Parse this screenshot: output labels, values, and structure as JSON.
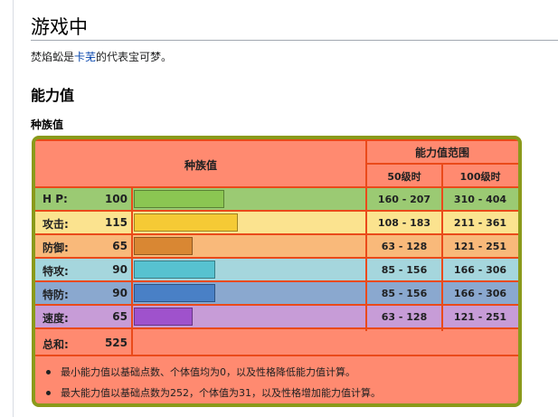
{
  "section_title": "游戏中",
  "intro": {
    "pokemon": "焚焰蚣",
    "mid": "是",
    "link": "卡芜",
    "tail": "的代表宝可梦。"
  },
  "stats_heading": "能力值",
  "base_heading": "种族值",
  "table": {
    "header_base": "种族值",
    "header_range": "能力值范围",
    "header_lv50": "50级时",
    "header_lv100": "100级时",
    "stats": [
      {
        "label": "H P:",
        "value": "100",
        "fraction": 0.392,
        "row_color": "#9bca73",
        "bar_color": "#8bc652",
        "lv50": "160 - 207",
        "lv100": "310 - 404"
      },
      {
        "label": "攻击:",
        "value": "115",
        "fraction": 0.451,
        "row_color": "#fbe38f",
        "bar_color": "#f5ca35",
        "lv50": "108 - 183",
        "lv100": "211 - 361"
      },
      {
        "label": "防御:",
        "value": "65",
        "fraction": 0.255,
        "row_color": "#f9b97a",
        "bar_color": "#d98733",
        "lv50": "63 - 128",
        "lv100": "121 - 251"
      },
      {
        "label": "特攻:",
        "value": "90",
        "fraction": 0.353,
        "row_color": "#a5d6dd",
        "bar_color": "#57c2d0",
        "lv50": "85 - 156",
        "lv100": "166 - 306"
      },
      {
        "label": "特防:",
        "value": "90",
        "fraction": 0.353,
        "row_color": "#8aa8cf",
        "bar_color": "#4980c6",
        "lv50": "85 - 156",
        "lv100": "166 - 306"
      },
      {
        "label": "速度:",
        "value": "65",
        "fraction": 0.255,
        "row_color": "#c79cd7",
        "bar_color": "#9f52cc",
        "lv50": "63 - 128",
        "lv100": "121 - 251"
      }
    ],
    "total_label": "总和:",
    "total_value": "525"
  },
  "notes": [
    "最小能力值以基础点数、个体值均为0，以及性格降低能力值计算。",
    "最大能力值以基础点数为252，个体值为31，以及性格增加能力值计算。"
  ]
}
